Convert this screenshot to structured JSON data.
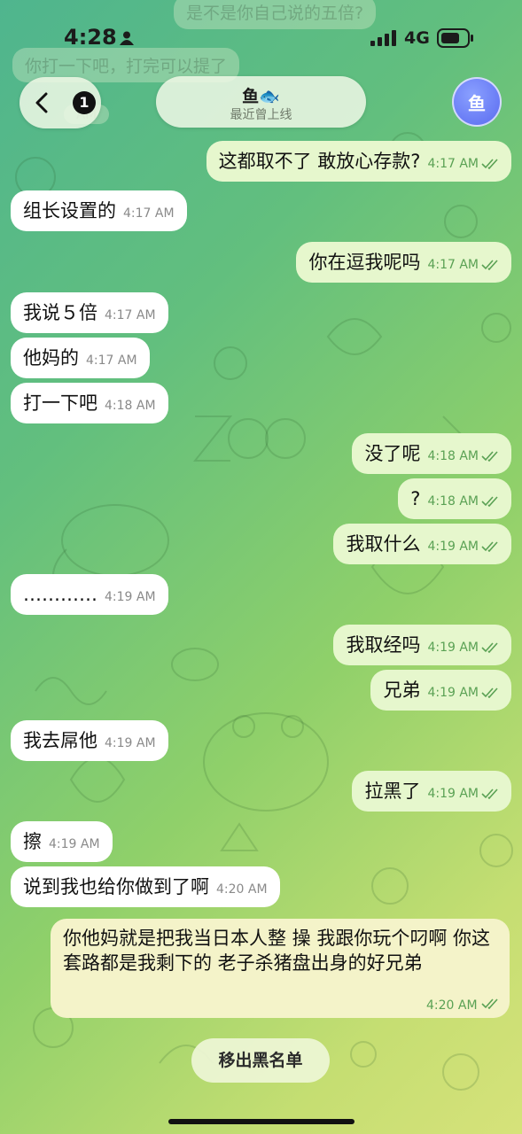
{
  "status_bar": {
    "time": "4:28",
    "network": "4G"
  },
  "header": {
    "back_badge": "1",
    "name": "鱼",
    "name_emoji": "🐟",
    "subtitle": "最近曾上线",
    "avatar_text": "鱼"
  },
  "ghost_messages": [
    {
      "text": "是不是你自己说的五倍?"
    },
    {
      "text": "你打一下吧，打完可以提了"
    },
    {
      "text": "AM"
    }
  ],
  "messages": [
    {
      "dir": "out",
      "text": "这都取不了 敢放心存款?",
      "time": "4:17 AM"
    },
    {
      "dir": "in",
      "text": "组长设置的",
      "time": "4:17 AM"
    },
    {
      "dir": "out",
      "text": "你在逗我呢吗",
      "time": "4:17 AM"
    },
    {
      "dir": "in",
      "text": "我说５倍",
      "time": "4:17 AM"
    },
    {
      "dir": "in",
      "text": "他妈的",
      "time": "4:17 AM"
    },
    {
      "dir": "in",
      "text": "打一下吧",
      "time": "4:18 AM"
    },
    {
      "dir": "out",
      "text": "没了呢",
      "time": "4:18 AM"
    },
    {
      "dir": "out",
      "text": "?",
      "time": "4:18 AM"
    },
    {
      "dir": "out",
      "text": "我取什么",
      "time": "4:19 AM"
    },
    {
      "dir": "in",
      "text": "…………",
      "time": "4:19 AM"
    },
    {
      "dir": "out",
      "text": "我取经吗",
      "time": "4:19 AM"
    },
    {
      "dir": "out",
      "text": "兄弟",
      "time": "4:19 AM"
    },
    {
      "dir": "in",
      "text": "我去屌他",
      "time": "4:19 AM"
    },
    {
      "dir": "out",
      "text": "拉黑了",
      "time": "4:19 AM"
    },
    {
      "dir": "in",
      "text": "擦",
      "time": "4:19 AM"
    },
    {
      "dir": "in",
      "text": "说到我也给你做到了啊",
      "time": "4:20 AM"
    }
  ],
  "long_message": {
    "text": "你他妈就是把我当日本人整 操 我跟你玩个叼啊 你这套路都是我剩下的 老子杀猪盘出身的好兄弟",
    "time": "4:20 AM"
  },
  "unblock_button": {
    "label": "移出黑名单"
  },
  "colors": {
    "incoming": "#ffffff",
    "outgoing": "#e6f7cd",
    "long_outgoing": "#f4f3c9",
    "check": "#5aa154",
    "avatar": "#5a6bf0"
  }
}
